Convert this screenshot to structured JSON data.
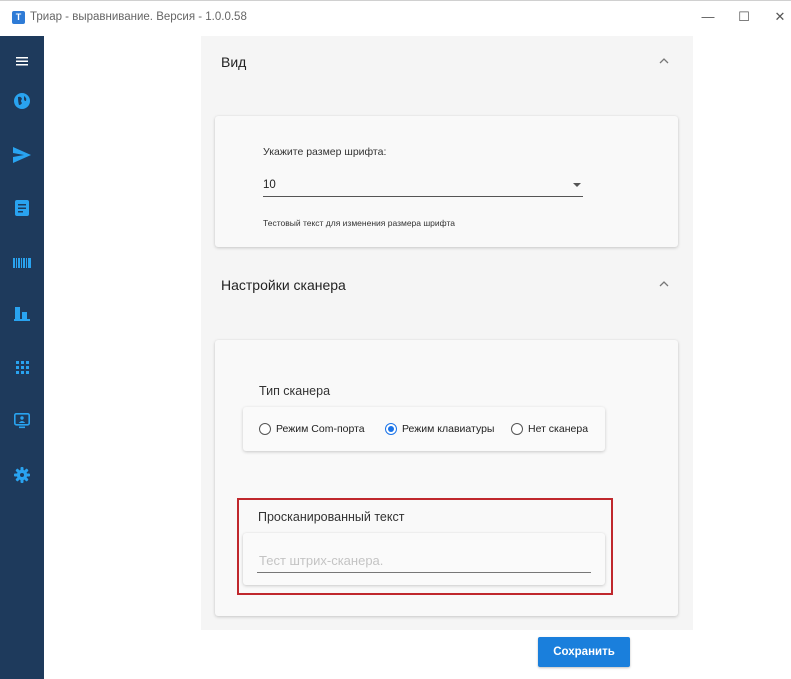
{
  "window": {
    "title": "Триар - выравнивание. Версия - 1.0.0.58",
    "app_icon_glyph": "Т",
    "minimize_glyph": "—",
    "maximize_glyph": "☐",
    "close_glyph": "✕"
  },
  "sidebar": {
    "background": "#1e3a5c",
    "icon_color": "#29a3f0",
    "items": [
      {
        "icon": "menu-icon"
      },
      {
        "icon": "globe-icon"
      },
      {
        "icon": "send-icon"
      },
      {
        "icon": "document-icon"
      },
      {
        "icon": "barcode-icon"
      },
      {
        "icon": "bar-chart-icon"
      },
      {
        "icon": "grid-icon"
      },
      {
        "icon": "monitor-icon"
      },
      {
        "icon": "gear-icon"
      }
    ]
  },
  "view_section": {
    "title": "Вид",
    "font_size_label": "Укажите размер шрифта:",
    "font_size_value": "10",
    "sample_text": "Тестовый текст для изменения размера шрифта"
  },
  "scanner_section": {
    "title": "Настройки сканера",
    "scanner_type_label": "Тип сканера",
    "options": [
      {
        "label": "Режим Com-порта",
        "checked": false
      },
      {
        "label": "Режим клавиатуры",
        "checked": true
      },
      {
        "label": "Нет сканера",
        "checked": false
      }
    ],
    "scanned_text_label": "Просканированный текст",
    "scanned_text_placeholder": "Тест штрих-сканера.",
    "scanned_text_value": ""
  },
  "actions": {
    "save_label": "Сохранить"
  },
  "colors": {
    "accent": "#1a7fdc",
    "highlight": "#c0282d"
  }
}
